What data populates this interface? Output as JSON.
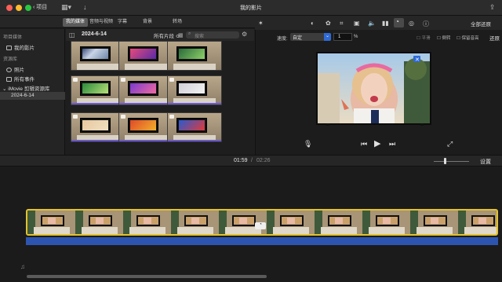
{
  "window": {
    "back_label": "项目",
    "title": "我的影片"
  },
  "tabs": [
    "我的媒体",
    "音频与视频",
    "字幕",
    "背景",
    "转场"
  ],
  "sidebar": {
    "section1": "项目媒体",
    "project_item": "我的影片",
    "section2": "资源库",
    "items": [
      "照片",
      "所有事件"
    ],
    "library": "iMovie 剪辑资源库",
    "event": "2024-6-14"
  },
  "browser": {
    "date": "2024-6-14",
    "filter": "所有片段 ≎",
    "search_placeholder": "搜索"
  },
  "viewer": {
    "speed_label": "速度:",
    "speed_value": "自定",
    "speed_number": "1",
    "speed_unit": "%",
    "options": [
      "平滑",
      "倒转",
      "保留音高"
    ],
    "reset_all": "全部还原",
    "reset": "还原"
  },
  "timeline": {
    "current": "01:59",
    "separator": "/",
    "total": "02:26",
    "settings": "设置"
  },
  "colors": {
    "accent": "#e4c22b",
    "audio": "#2d55b0",
    "selected_tab": "#5b5b5b"
  }
}
